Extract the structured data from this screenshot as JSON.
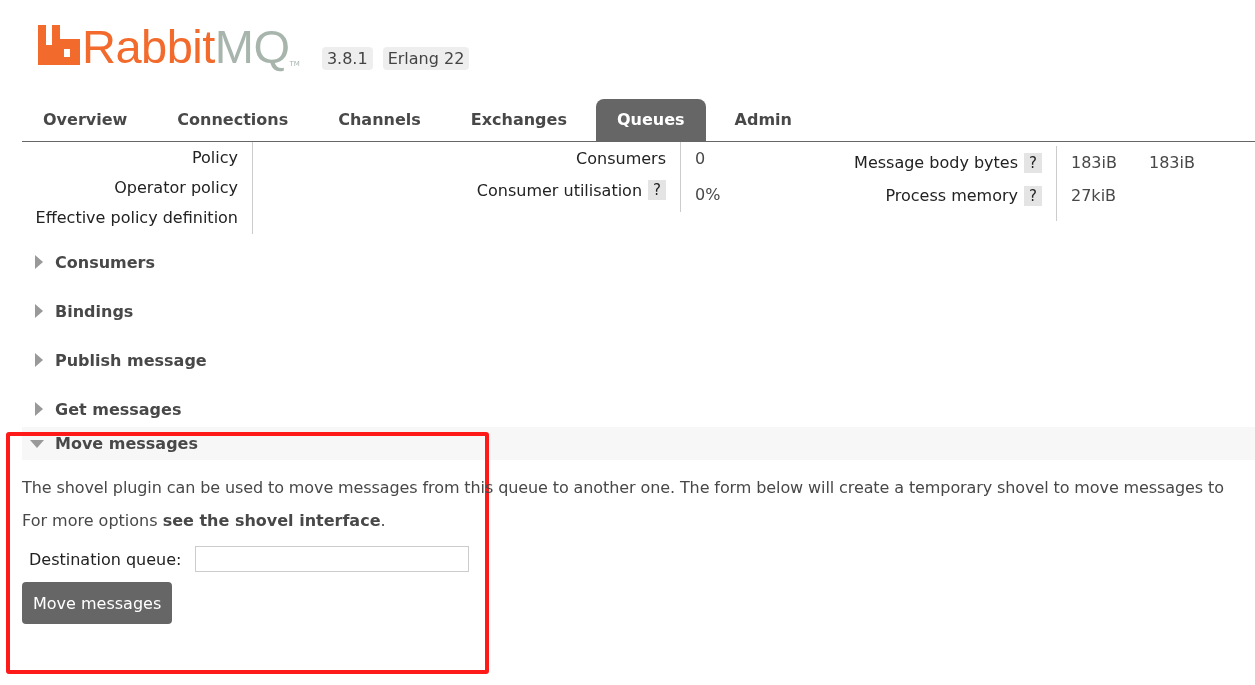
{
  "header": {
    "logo": {
      "word_a": "Rabbit",
      "word_b": "MQ",
      "mark": "TM"
    },
    "version": "3.8.1",
    "erlang": "Erlang 22"
  },
  "tabs": [
    {
      "label": "Overview",
      "selected": false
    },
    {
      "label": "Connections",
      "selected": false
    },
    {
      "label": "Channels",
      "selected": false
    },
    {
      "label": "Exchanges",
      "selected": false
    },
    {
      "label": "Queues",
      "selected": true
    },
    {
      "label": "Admin",
      "selected": false
    }
  ],
  "details": {
    "column_1": [
      {
        "label": "Policy"
      },
      {
        "label": "Operator policy"
      },
      {
        "label": "Effective policy definition"
      }
    ],
    "column_2": [
      {
        "label": "Consumers",
        "values": [
          "0"
        ]
      },
      {
        "label": "Consumer utilisation",
        "help_text": "?",
        "values": [
          "0%"
        ]
      }
    ],
    "column_3": [
      {
        "label": "Message body bytes",
        "help_text": "?",
        "values": [
          "183iB",
          "183iB"
        ]
      },
      {
        "label": "Process memory",
        "help_text": "?",
        "values": [
          "27kiB"
        ]
      }
    ]
  },
  "sections": [
    {
      "title": "Consumers",
      "expanded": false
    },
    {
      "title": "Bindings",
      "expanded": false
    },
    {
      "title": "Publish message",
      "expanded": false
    },
    {
      "title": "Get messages",
      "expanded": false
    },
    {
      "title": "Move messages",
      "expanded": true
    }
  ],
  "move_messages": {
    "description": "The shovel plugin can be used to move messages from this queue to another one. The form below will create a temporary shovel to move messages to",
    "more_options": "For more options **see the shovel interface**.",
    "destination_label": "Destination queue:",
    "button": "Move messages"
  },
  "annotation": {
    "kind": "highlight"
  }
}
